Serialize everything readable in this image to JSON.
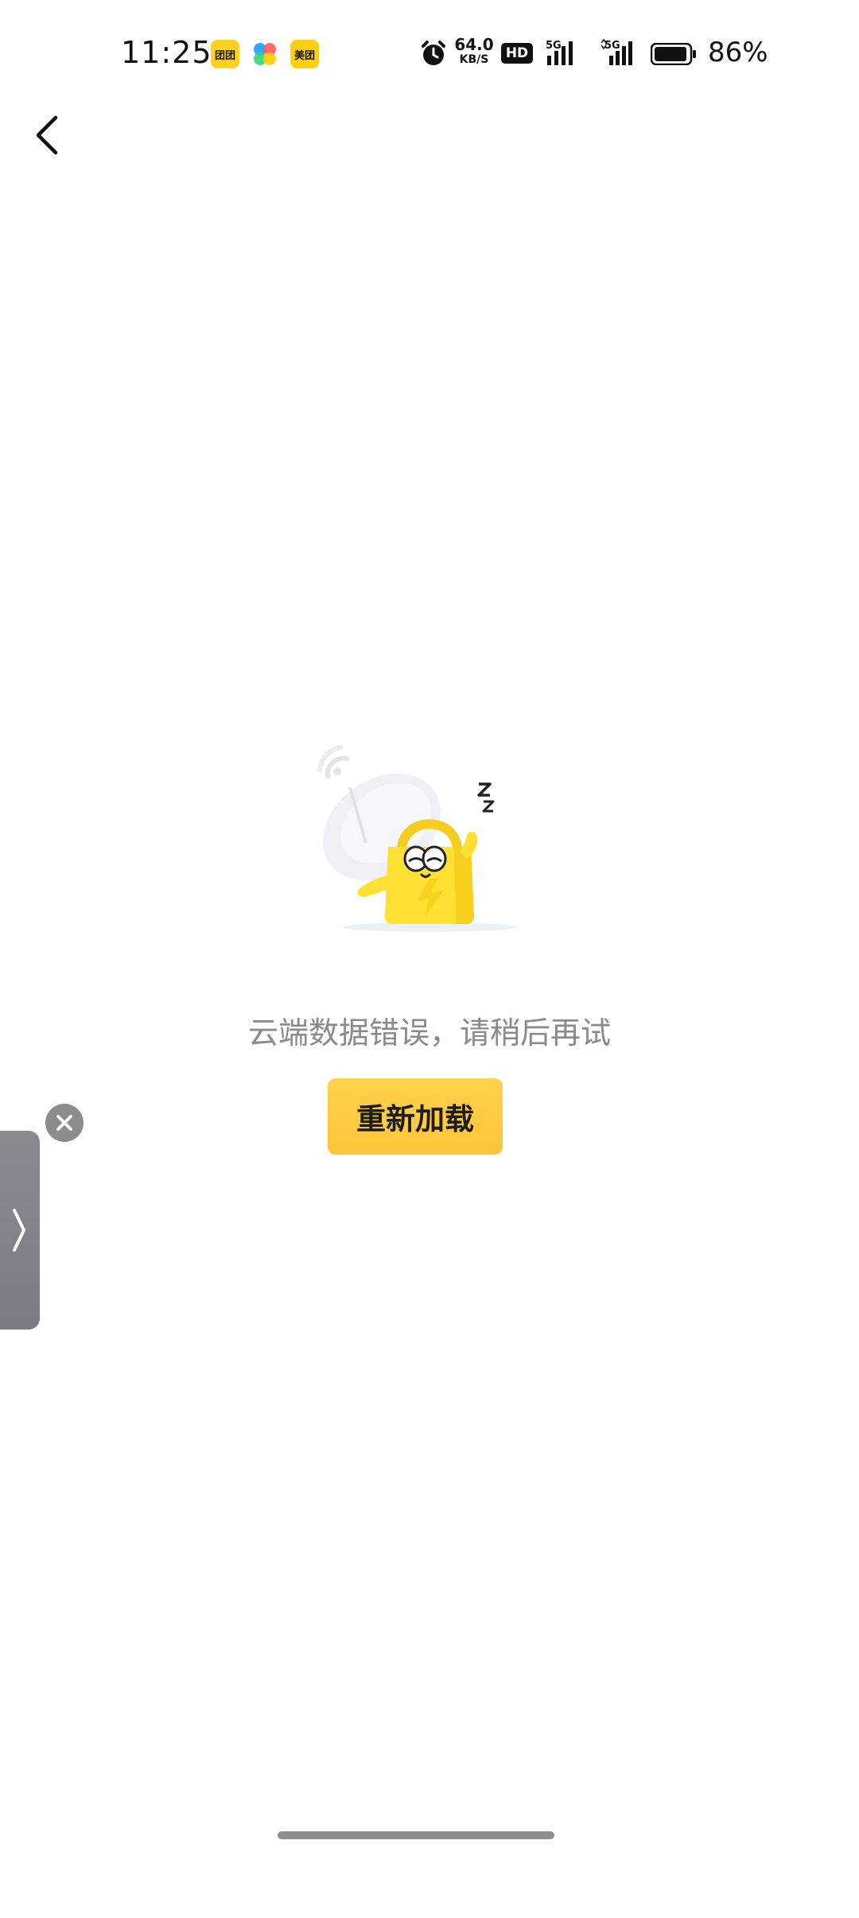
{
  "status_bar": {
    "time": "11:25",
    "app_icons": [
      {
        "name": "cheat-app-icon",
        "label": "团团"
      },
      {
        "name": "colorful-app-icon",
        "label": ""
      },
      {
        "name": "meituan-app-icon",
        "label": "美团"
      }
    ],
    "net_speed_value": "64.0",
    "net_speed_unit": "KB/S",
    "hd_badge": "HD",
    "signal1_label": "5G",
    "signal2_label": "5G",
    "battery_percent": "86%"
  },
  "content": {
    "error_message": "云端数据错误，请稍后再试",
    "reload_label": "重新加载"
  },
  "colors": {
    "accent": "#ffc93f",
    "text_gray": "#8a8a8a",
    "mascot_yellow": "#ffe033"
  }
}
